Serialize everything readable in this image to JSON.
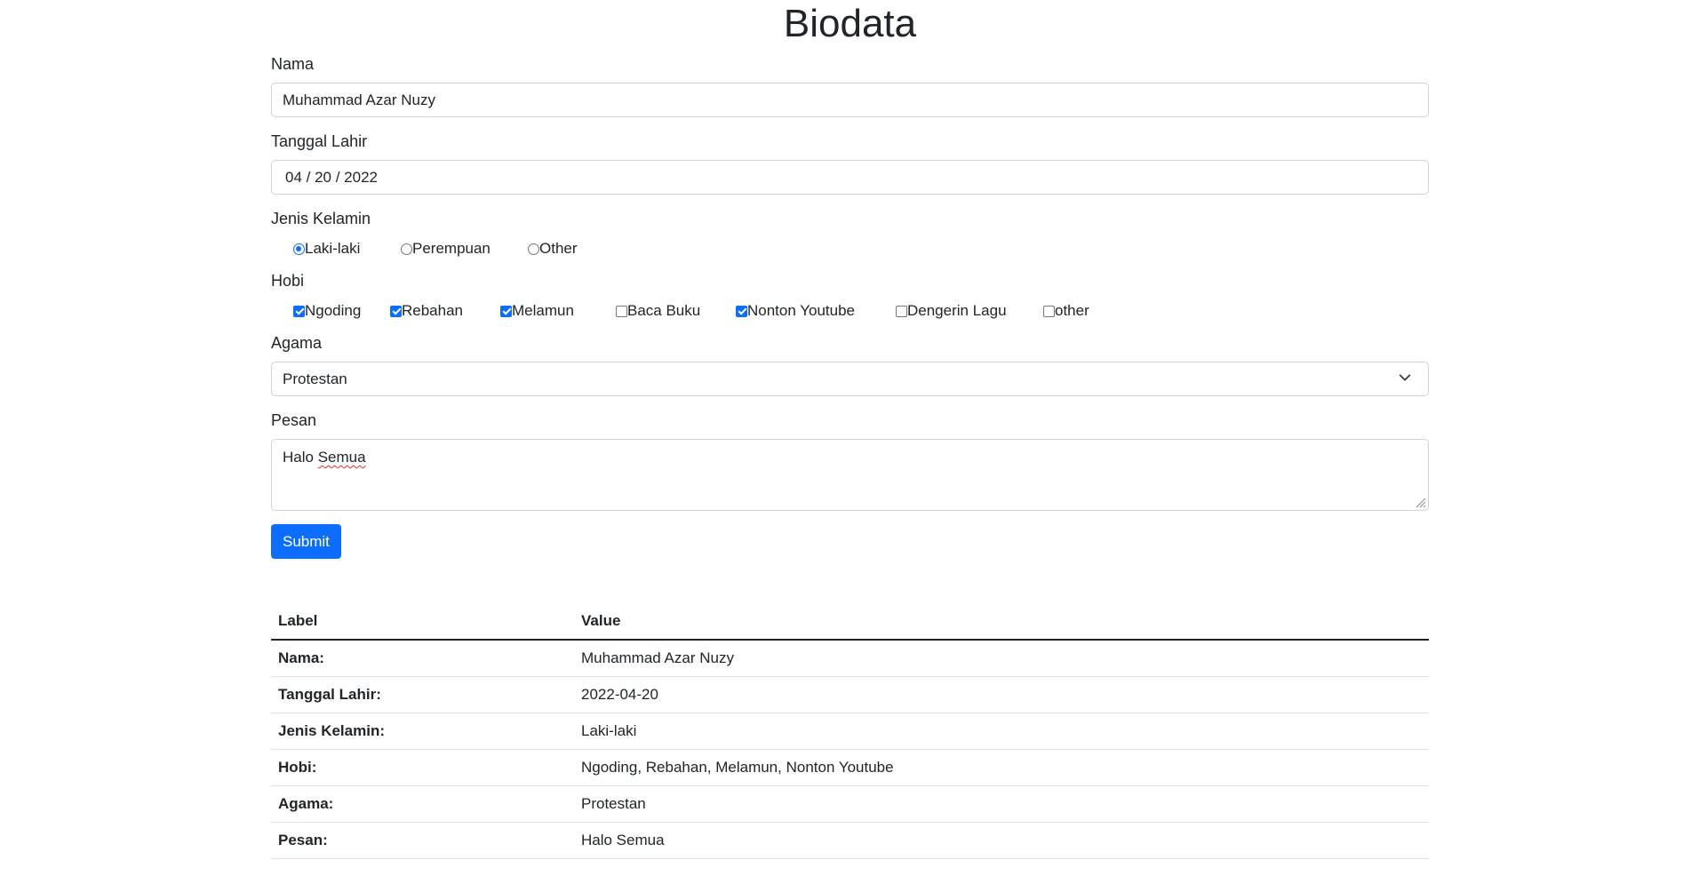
{
  "page_title": "Biodata",
  "form": {
    "nama": {
      "label": "Nama",
      "value": "Muhammad Azar Nuzy"
    },
    "tanggal_lahir": {
      "label": "Tanggal Lahir",
      "value": "04 / 20 / 2022"
    },
    "jenis_kelamin": {
      "label": "Jenis Kelamin",
      "options": [
        {
          "label": "Laki-laki",
          "checked": true
        },
        {
          "label": "Perempuan",
          "checked": false
        },
        {
          "label": "Other",
          "checked": false
        }
      ]
    },
    "hobi": {
      "label": "Hobi",
      "options": [
        {
          "label": "Ngoding",
          "checked": true
        },
        {
          "label": "Rebahan",
          "checked": true
        },
        {
          "label": "Melamun",
          "checked": true
        },
        {
          "label": "Baca Buku",
          "checked": false
        },
        {
          "label": "Nonton Youtube",
          "checked": true
        },
        {
          "label": "Dengerin Lagu",
          "checked": false
        },
        {
          "label": "other",
          "checked": false
        }
      ]
    },
    "agama": {
      "label": "Agama",
      "value": "Protestan",
      "icon": "chevron-down-icon"
    },
    "pesan": {
      "label": "Pesan",
      "value_first": "Halo",
      "value_second": "Semua"
    },
    "submit_label": "Submit"
  },
  "result_table": {
    "headers": [
      "Label",
      "Value"
    ],
    "rows": [
      {
        "label": "Nama:",
        "value": "Muhammad Azar Nuzy"
      },
      {
        "label": "Tanggal Lahir:",
        "value": "2022-04-20"
      },
      {
        "label": "Jenis Kelamin:",
        "value": "Laki-laki"
      },
      {
        "label": "Hobi:",
        "value": "Ngoding, Rebahan, Melamun, Nonton Youtube"
      },
      {
        "label": "Agama:",
        "value": "Protestan"
      },
      {
        "label": "Pesan:",
        "value": "Halo Semua"
      }
    ]
  },
  "colors": {
    "accent": "#0d6efd",
    "border": "#ced4da",
    "text": "#212529"
  }
}
